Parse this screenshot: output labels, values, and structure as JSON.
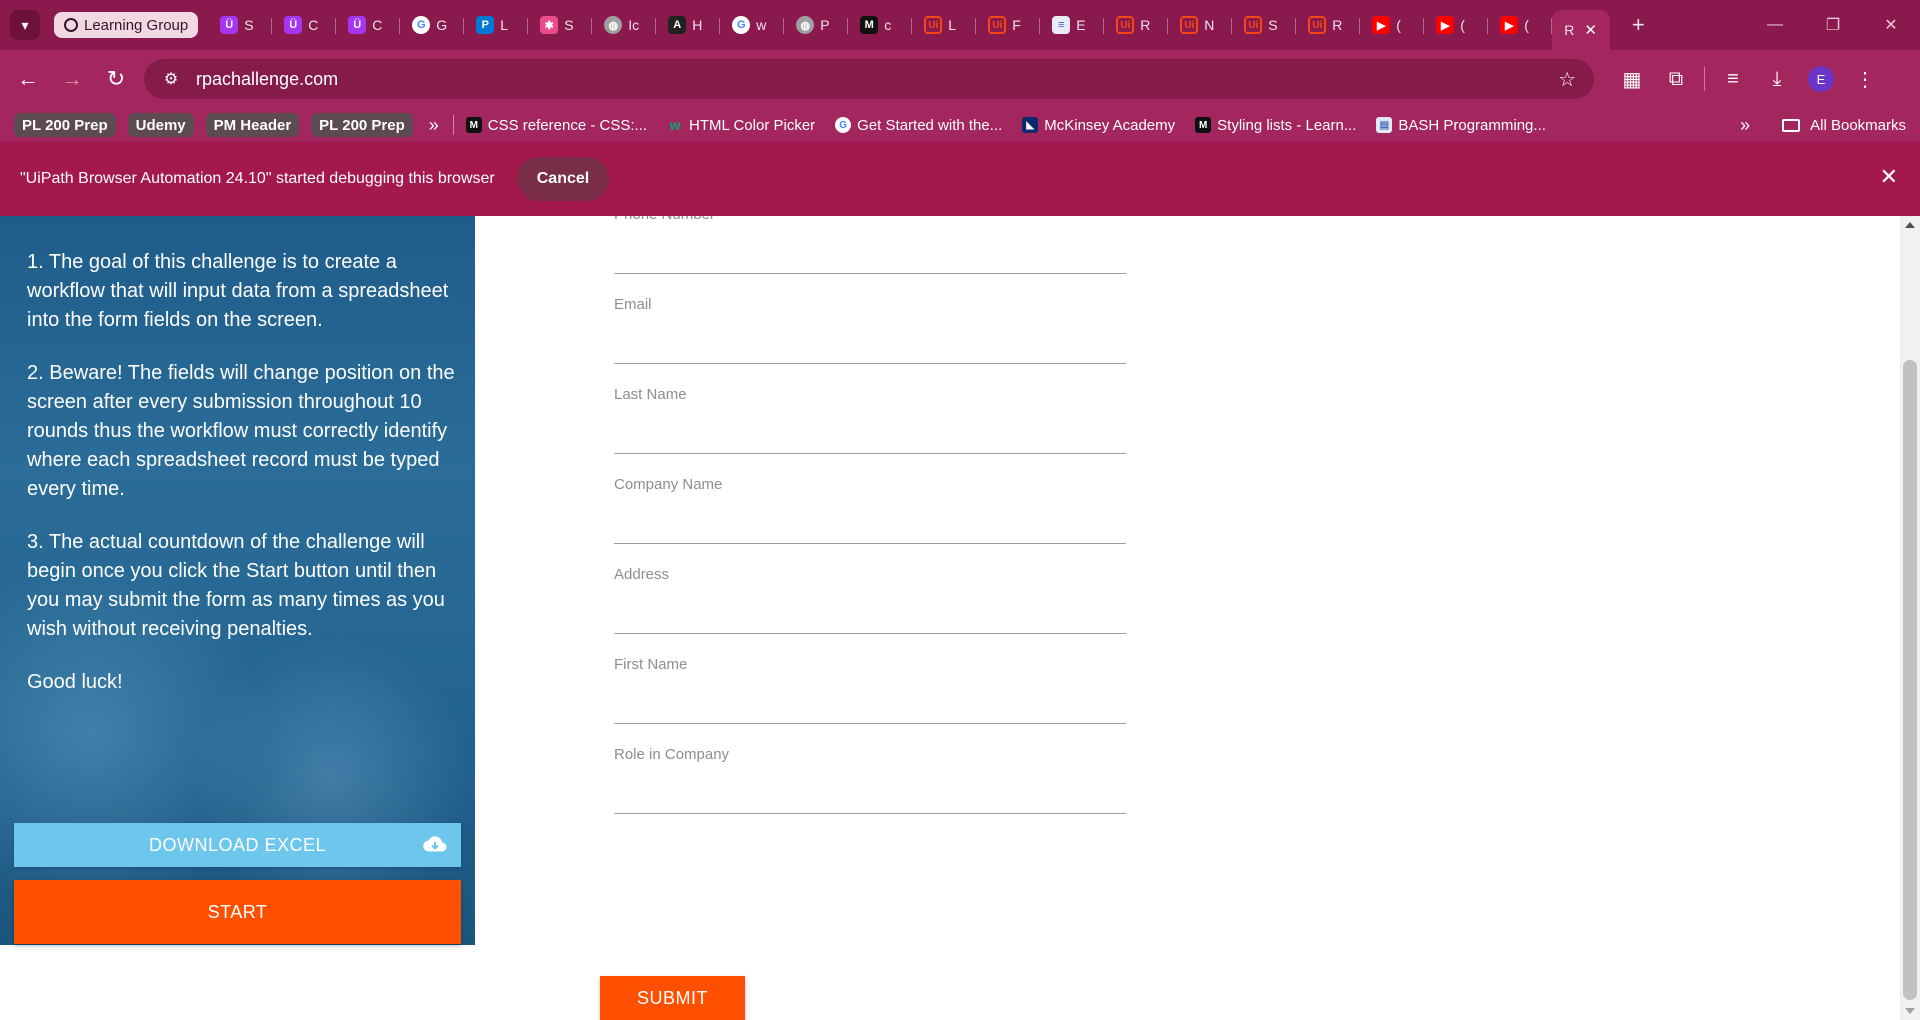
{
  "browser": {
    "tab_group_label": "Learning Group",
    "tabs": [
      {
        "label": "S",
        "icon": "udemy-icon",
        "color": "#a435f0",
        "glyph": "Ü"
      },
      {
        "label": "C",
        "icon": "udemy-icon",
        "color": "#a435f0",
        "glyph": "Ü"
      },
      {
        "label": "C",
        "icon": "udemy-icon",
        "color": "#a435f0",
        "glyph": "Ü"
      },
      {
        "label": "G",
        "icon": "google-icon",
        "color": "#ffffff",
        "glyph": "G"
      },
      {
        "label": "L",
        "icon": "powerapps-icon",
        "color": "#0078d4",
        "glyph": "P"
      },
      {
        "label": "S",
        "icon": "flow-icon",
        "color": "#ea4c89",
        "glyph": "✱"
      },
      {
        "label": "Ic",
        "icon": "globe-icon",
        "color": "#9e9e9e",
        "glyph": "◍"
      },
      {
        "label": "H",
        "icon": "ai-icon",
        "color": "#222222",
        "glyph": "A"
      },
      {
        "label": "w",
        "icon": "google-icon",
        "color": "#ffffff",
        "glyph": "G"
      },
      {
        "label": "P",
        "icon": "globe-icon",
        "color": "#9e9e9e",
        "glyph": "◍"
      },
      {
        "label": "c",
        "icon": "mdn-icon",
        "color": "#111111",
        "glyph": "M"
      },
      {
        "label": "L",
        "icon": "uipath-icon",
        "color": "#fa4616",
        "glyph": "Ui"
      },
      {
        "label": "F",
        "icon": "uipath-icon",
        "color": "#fa4616",
        "glyph": "Ui"
      },
      {
        "label": "E",
        "icon": "document-icon",
        "color": "#e8eaf6",
        "glyph": "≡"
      },
      {
        "label": "R",
        "icon": "uipath-icon",
        "color": "#fa4616",
        "glyph": "Ui"
      },
      {
        "label": "N",
        "icon": "uipath-icon",
        "color": "#fa4616",
        "glyph": "Ui"
      },
      {
        "label": "S",
        "icon": "uipath-icon",
        "color": "#fa4616",
        "glyph": "Ui"
      },
      {
        "label": "R",
        "icon": "uipath-icon",
        "color": "#fa4616",
        "glyph": "Ui"
      },
      {
        "label": "(",
        "icon": "youtube-icon",
        "color": "#ff0000",
        "glyph": "▶"
      },
      {
        "label": "(",
        "icon": "youtube-icon",
        "color": "#ff0000",
        "glyph": "▶"
      },
      {
        "label": "(",
        "icon": "youtube-icon",
        "color": "#ff0000",
        "glyph": "▶"
      }
    ],
    "active_tab_label": "R",
    "url": "rpachallenge.com",
    "profile_initial": "E",
    "bookmark_chips": [
      "PL 200 Prep",
      "Udemy",
      "PM Header",
      "PL 200 Prep"
    ],
    "bookmarks": [
      {
        "label": "CSS reference - CSS:...",
        "icon": "mdn-icon",
        "glyph": "M",
        "color": "#111111"
      },
      {
        "label": "HTML Color Picker",
        "icon": "w3schools-icon",
        "glyph": "w",
        "color": "#04aa6d"
      },
      {
        "label": "Get Started with the...",
        "icon": "google-icon",
        "glyph": "G",
        "color": "#ffffff"
      },
      {
        "label": "McKinsey Academy",
        "icon": "mckinsey-icon",
        "glyph": "◣",
        "color": "#0a2a6b"
      },
      {
        "label": "Styling lists - Learn...",
        "icon": "mdn-icon",
        "glyph": "M",
        "color": "#111111"
      },
      {
        "label": "BASH Programming...",
        "icon": "page-icon",
        "glyph": "▤",
        "color": "#dfe7f5"
      }
    ],
    "all_bookmarks_label": "All Bookmarks",
    "debug_message": "\"UiPath Browser Automation 24.10\" started debugging this browser",
    "debug_cancel_label": "Cancel"
  },
  "page": {
    "instructions": [
      "1. The goal of this challenge is to create a workflow that will input data from a spreadsheet into the form fields on the screen.",
      "2. Beware! The fields will change position on the screen after every submission throughout 10 rounds thus the workflow must correctly identify where each spreadsheet record must be typed every time.",
      "3. The actual countdown of the challenge will begin once you click the Start button until then you may submit the form as many times as you wish without receiving penalties.",
      "Good luck!"
    ],
    "download_label": "DOWNLOAD EXCEL",
    "start_label": "START",
    "fields": [
      {
        "label": "Phone Number",
        "value": ""
      },
      {
        "label": "Email",
        "value": ""
      },
      {
        "label": "Last Name",
        "value": ""
      },
      {
        "label": "Company Name",
        "value": ""
      },
      {
        "label": "Address",
        "value": ""
      },
      {
        "label": "First Name",
        "value": ""
      },
      {
        "label": "Role in Company",
        "value": ""
      }
    ],
    "submit_label": "SUBMIT"
  },
  "colors": {
    "browser_frame": "#a3265f",
    "accent_orange": "#fe5000",
    "download_blue": "#6dc6ec"
  }
}
